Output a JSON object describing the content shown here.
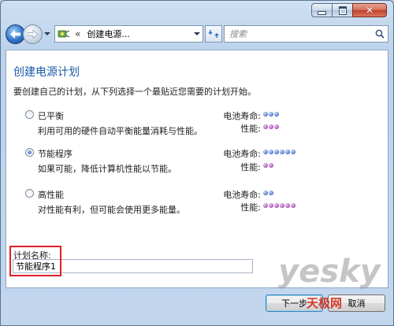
{
  "navigation": {
    "address_path": "创建电源...",
    "address_chevron": "«",
    "search_placeholder": "搜索"
  },
  "page": {
    "heading": "创建电源计划",
    "intro": "要创建自己的计划，从下列选择一个最贴近您需要的计划开始。",
    "battery_label": "电池寿命:",
    "performance_label": "性能:",
    "plans": [
      {
        "name": "已平衡",
        "description": "利用可用的硬件自动平衡能量消耗与性能。",
        "selected": false,
        "battery_life": 3,
        "performance": 3
      },
      {
        "name": "节能程序",
        "description": "如果可能，降低计算机性能以节能。",
        "selected": true,
        "battery_life": 6,
        "performance": 2
      },
      {
        "name": "高性能",
        "description": "对性能有利，但可能会使用更多能量。",
        "selected": false,
        "battery_life": 2,
        "performance": 6
      }
    ],
    "plan_name_label": "计划名称:",
    "plan_name_value": "节能程序1"
  },
  "buttons": {
    "next": "下一步",
    "cancel": "取消"
  },
  "watermark": {
    "brand": "yesky",
    "sub": "天极网"
  },
  "colors": {
    "heading": "#1b5aa8",
    "battery_dot": "#4a72c8",
    "performance_dot": "#a54db3",
    "highlight_box": "#e0202a"
  }
}
